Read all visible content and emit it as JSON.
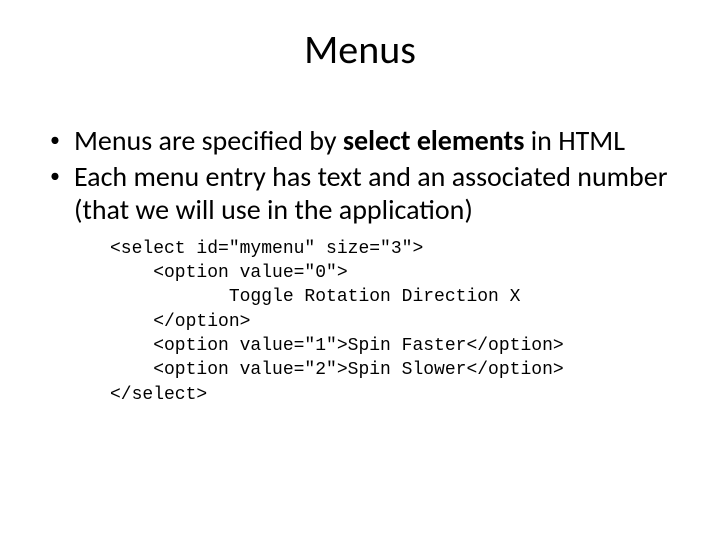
{
  "title": "Menus",
  "bullets": [
    {
      "pre": "Menus are specified by ",
      "bold": "select elements",
      "post": " in HTML"
    },
    {
      "pre": "Each menu entry has text and an associated number (that we will use in the application)",
      "bold": "",
      "post": ""
    }
  ],
  "code": "<select id=\"mymenu\" size=\"3\">\n    <option value=\"0\">\n           Toggle Rotation Direction X\n    </option>\n    <option value=\"1\">Spin Faster</option>\n    <option value=\"2\">Spin Slower</option>\n</select>"
}
